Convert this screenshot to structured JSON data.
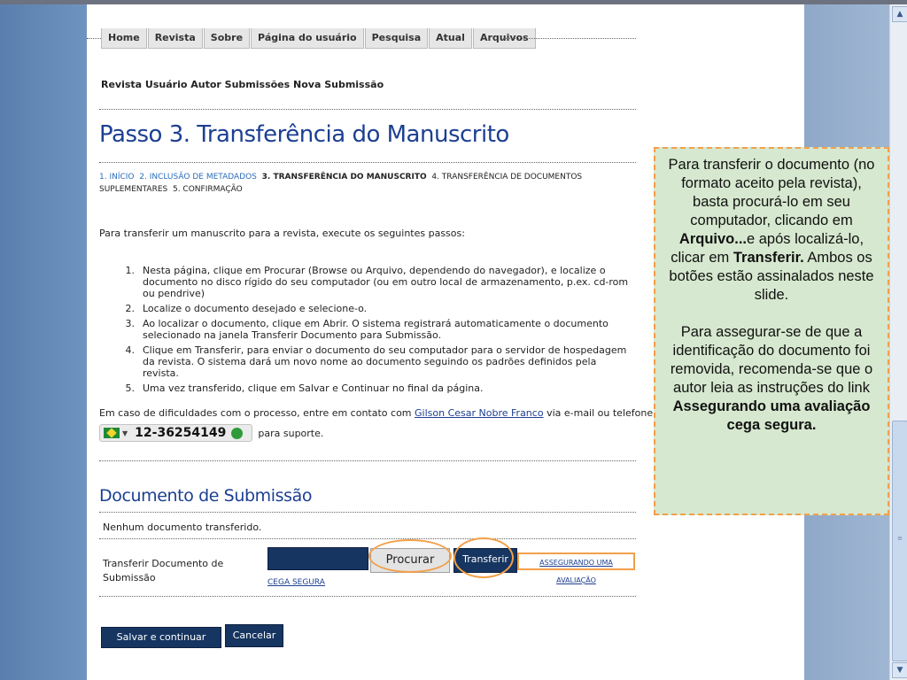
{
  "nav": {
    "tabs": [
      "Home",
      "Revista",
      "Sobre",
      "Página do usuário",
      "Pesquisa",
      "Atual",
      "Arquivos"
    ]
  },
  "breadcrumb": "Revista Usuário Autor Submissões Nova Submissão",
  "title": "Passo 3. Transferência do Manuscrito",
  "steps": {
    "s1": "1. INÍCIO",
    "s2": "2. INCLUSÃO DE METADADOS",
    "s3": "3. TRANSFERÊNCIA DO MANUSCRITO",
    "s4": "4. TRANSFERÊNCIA DE DOCUMENTOS SUPLEMENTARES",
    "s5": "5. CONFIRMAÇÃO"
  },
  "intro": "Para transferir um manuscrito para a revista, execute os seguintes passos:",
  "instructions": [
    {
      "n": "1.",
      "text": "Nesta página, clique em Procurar (Browse ou Arquivo, dependendo do navegador), e localize o documento no disco rígido do seu computador (ou em outro local de armazenamento, p.ex. cd-rom ou pendrive)"
    },
    {
      "n": "2.",
      "text": "Localize o documento desejado e selecione-o."
    },
    {
      "n": "3.",
      "text": "Ao localizar o documento, clique em Abrir. O sistema registrará automaticamente o documento selecionado na janela Transferir Documento para Submissão."
    },
    {
      "n": "4.",
      "text": "Clique em Transferir, para enviar o documento do seu computador para o servidor de hospedagem da revista. O sistema dará um novo nome ao documento seguindo os padrões definidos pela revista."
    },
    {
      "n": "5.",
      "text": "Uma vez transferido, clique em Salvar e Continuar no final da página."
    }
  ],
  "contact": {
    "prefix": "Em caso de dificuldades com o processo, entre em contato com",
    "name": "Gilson Cesar Nobre Franco",
    "suffix": "via e-mail ou telefone",
    "phone": "12-36254149",
    "support": "para suporte."
  },
  "submission": {
    "title": "Documento de Submissão",
    "none": "Nenhum documento transferido.",
    "file_label": "Transferir Documento de Submissão",
    "browse": "Procurar",
    "upload": "Transferir",
    "blind_link_1": "ASSEGURANDO UMA AVALIAÇÃO",
    "blind_link_2": "CEGA SEGURA",
    "save": "Salvar e continuar",
    "cancel": "Cancelar"
  },
  "callout": {
    "p1_a": "Para transferir o documento (no formato aceito pela revista), basta procurá-lo em seu computador, clicando em",
    "p1_b": "Arquivo...",
    "p1_c": "e após localizá-lo, clicar em",
    "p1_d": "Transferir.",
    "p1_e": "Ambos os botões estão assinalados neste slide.",
    "p2_a": "Para assegurar-se de que a identificação do documento foi removida, recomenda-se que o autor leia as instruções do link",
    "p2_b": "Assegurando uma avaliação cega segura."
  },
  "colors": {
    "brand_blue": "#1c3f92",
    "button_navy": "#163561",
    "highlight_orange": "#f2a04a",
    "callout_green": "#d6e8cf"
  }
}
